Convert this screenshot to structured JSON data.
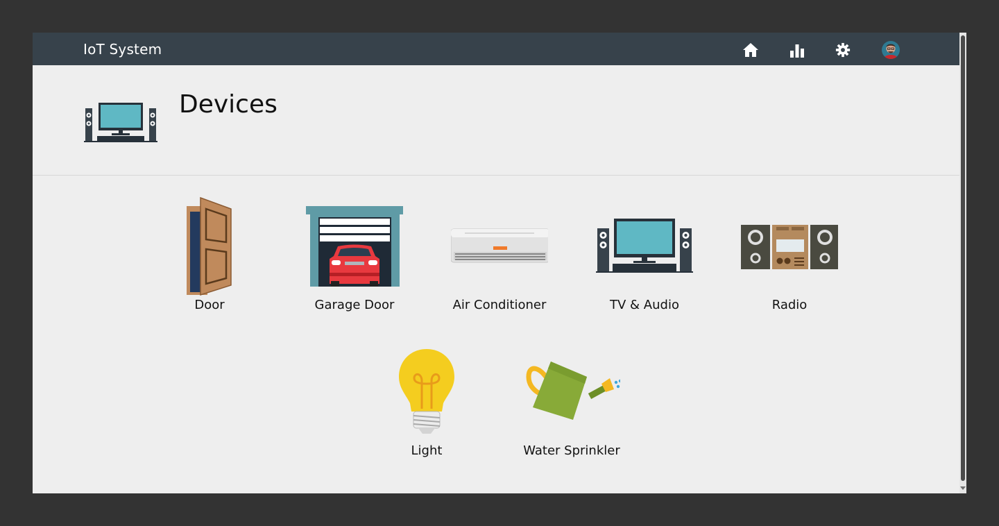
{
  "app": {
    "title": "IoT System"
  },
  "nav": {
    "icons": [
      "home-icon",
      "bar-chart-icon",
      "gear-icon",
      "avatar"
    ]
  },
  "page": {
    "title": "Devices",
    "icon": "tv-audio-icon"
  },
  "devices": [
    {
      "label": "Door",
      "icon": "door-icon"
    },
    {
      "label": "Garage Door",
      "icon": "garage-door-icon"
    },
    {
      "label": "Air Conditioner",
      "icon": "air-conditioner-icon"
    },
    {
      "label": "TV & Audio",
      "icon": "tv-audio-icon"
    },
    {
      "label": "Radio",
      "icon": "radio-icon"
    },
    {
      "label": "Light",
      "icon": "light-bulb-icon"
    },
    {
      "label": "Water Sprinkler",
      "icon": "watering-can-icon"
    }
  ],
  "colors": {
    "topbar": "#37424b",
    "background": "#eeeeee",
    "outer": "#333333"
  }
}
